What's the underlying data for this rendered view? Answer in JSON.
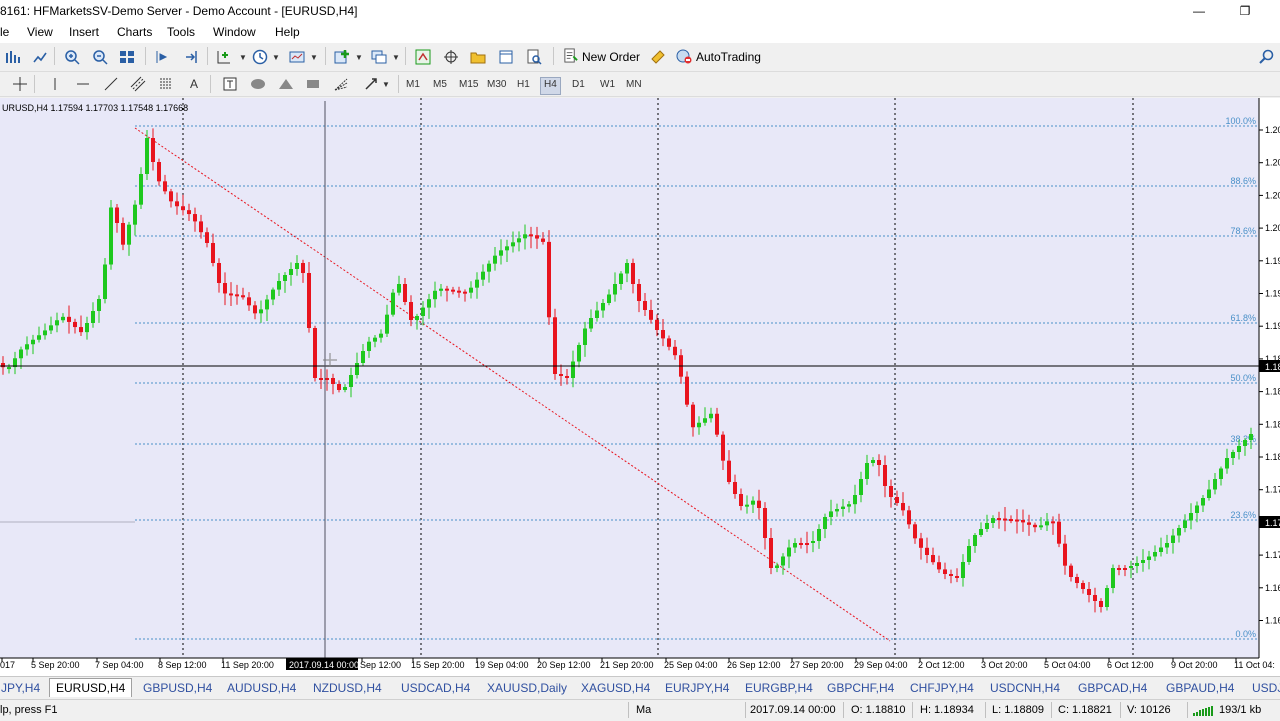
{
  "window": {
    "title": "8161: HFMarketsSV-Demo Server - Demo Account - [EURUSD,H4]",
    "minimize_glyph": "—",
    "restore_glyph": "❐"
  },
  "menu": [
    "le",
    "View",
    "Insert",
    "Charts",
    "Tools",
    "Window",
    "Help"
  ],
  "toolbar": {
    "new_order_label": "New Order",
    "autotrading_label": "AutoTrading",
    "timeframes": [
      "M1",
      "M5",
      "M15",
      "M30",
      "H1",
      "H4",
      "D1",
      "W1",
      "MN"
    ],
    "active_timeframe": "H4"
  },
  "chart": {
    "info_label": "URUSD,H4  1.17594 1.17703 1.17548 1.17668",
    "crosshair_date_label": "2017.09.14 00:00",
    "price_labels": [
      "1.20",
      "1.20",
      "1.20",
      "1.20",
      "1.19",
      "1.19",
      "1.19",
      "1.18",
      "1.18",
      "1.18",
      "1.18",
      "1.17",
      "1.17",
      "1.17",
      "1.16",
      "1.16"
    ],
    "current_price_tag": "1.18",
    "crosshair_price_tag": "1.17",
    "fib_levels": [
      "100.0%",
      "88.6%",
      "78.6%",
      "61.8%",
      "50.0%",
      "38.2%",
      "23.6%",
      "0.0%"
    ],
    "time_labels": [
      "017",
      "5 Sep 20:00",
      "7 Sep 04:00",
      "8 Sep 12:00",
      "11 Sep 20:00",
      "Sep 12:00",
      "15 Sep 20:00",
      "19 Sep 04:00",
      "20 Sep 12:00",
      "21 Sep 20:00",
      "25 Sep 04:00",
      "26 Sep 12:00",
      "27 Sep 20:00",
      "29 Sep 04:00",
      "2 Oct 12:00",
      "3 Oct 20:00",
      "5 Oct 04:00",
      "6 Oct 12:00",
      "9 Oct 20:00",
      "11 Oct 04:"
    ],
    "colors": {
      "bg": "#e8e8f8",
      "bull": "#1ec81e",
      "bear": "#e8141e",
      "fib": "#4a90c8",
      "trend": "#e8141e",
      "grid": "#000000"
    }
  },
  "tabs": [
    "JPY,H4",
    "EURUSD,H4",
    "GBPUSD,H4",
    "AUDUSD,H4",
    "NZDUSD,H4",
    "USDCAD,H4",
    "XAUUSD,Daily",
    "XAGUSD,H4",
    "EURJPY,H4",
    "EURGBP,H4",
    "GBPCHF,H4",
    "CHFJPY,H4",
    "USDCNH,H4",
    "GBPCAD,H4",
    "GBPAUD,H4",
    "USDJ"
  ],
  "active_tab": "EURUSD,H4",
  "status": {
    "help": "lp, press F1",
    "profile": "Ma",
    "datetime": "2017.09.14 00:00",
    "open": "O: 1.18810",
    "high": "H: 1.18934",
    "low": "L: 1.18809",
    "close": "C: 1.18821",
    "volume": "V: 10126",
    "traffic": "193/1 kb"
  }
}
